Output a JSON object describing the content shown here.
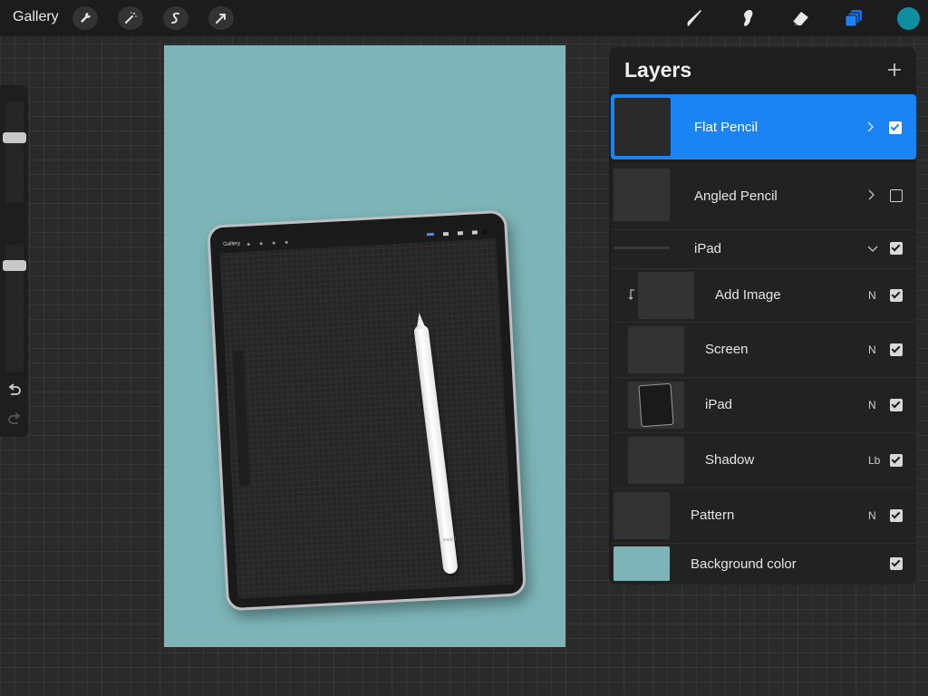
{
  "toolbar": {
    "gallery_label": "Gallery",
    "left_tools": [
      "wrench-icon",
      "magic-wand-icon",
      "s-curve-icon",
      "arrow-cursor-icon"
    ],
    "right_tools": [
      "brush-icon",
      "smudge-icon",
      "eraser-icon",
      "layers-icon"
    ],
    "active_color": "#0e8ea0",
    "layers_icon_color": "#1a6fe0"
  },
  "canvas": {
    "background_color": "#7cb4b7",
    "mockup_gallery_label": "Gallery",
    "pencil_brand": "Pencil"
  },
  "layers_panel": {
    "title": "Layers",
    "add_icon": "plus-icon",
    "layers": [
      {
        "name": "Flat Pencil",
        "active": true,
        "visible": true,
        "control": "chevron-right-icon"
      },
      {
        "name": "Angled Pencil",
        "active": false,
        "visible": false,
        "control": "chevron-right-icon"
      },
      {
        "name": "iPad",
        "group": true,
        "visible": true,
        "control": "chevron-down-icon"
      },
      {
        "name": "Add Image",
        "blend": "N",
        "visible": true,
        "clipped": true
      },
      {
        "name": "Screen",
        "blend": "N",
        "visible": true
      },
      {
        "name": "iPad",
        "blend": "N",
        "visible": true
      },
      {
        "name": "Shadow",
        "blend": "Lb",
        "visible": true
      },
      {
        "name": "Pattern",
        "blend": "N",
        "visible": true
      },
      {
        "name": "Background color",
        "visible": true,
        "swatch": "#7cb4b7"
      }
    ]
  }
}
